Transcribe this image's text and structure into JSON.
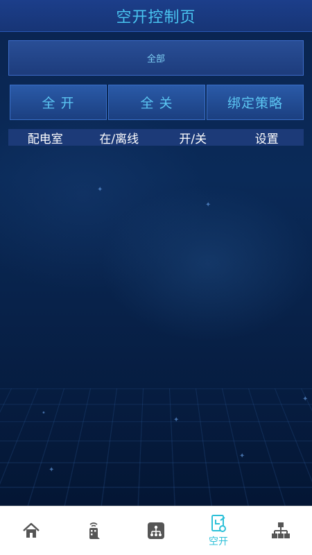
{
  "header": {
    "title": "空开控制页"
  },
  "filter": {
    "selected": "全部"
  },
  "actions": {
    "all_on": "全 开",
    "all_off": "全 关",
    "bind_policy": "绑定策略"
  },
  "table": {
    "columns": [
      "配电室",
      "在/离线",
      "开/关",
      "设置"
    ]
  },
  "nav": {
    "items": [
      {
        "icon": "home-icon",
        "label": "",
        "active": false
      },
      {
        "icon": "remote-control-icon",
        "label": "",
        "active": false
      },
      {
        "icon": "network-device-icon",
        "label": "",
        "active": false
      },
      {
        "icon": "breaker-switch-icon",
        "label": "空开",
        "active": true
      },
      {
        "icon": "topology-icon",
        "label": "",
        "active": false
      }
    ],
    "active_color": "#2cc0d8",
    "inactive_color": "#555555"
  }
}
